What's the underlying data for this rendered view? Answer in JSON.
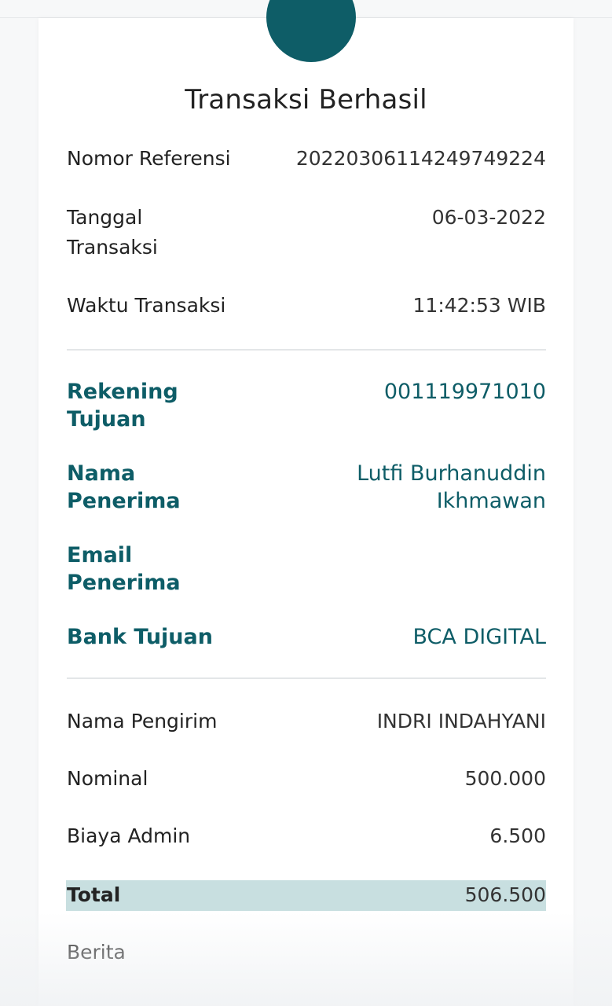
{
  "title": "Transaksi Berhasil",
  "colors": {
    "accent": "#0e5d67",
    "total_highlight": "#c8dfe0"
  },
  "icons": {
    "status": "check-icon"
  },
  "details": {
    "ref_label": "Nomor Referensi",
    "ref_value": "20220306114249749224",
    "date_label": "Tanggal Transaksi",
    "date_value": "06-03-2022",
    "time_label": "Waktu Transaksi",
    "time_value": "11:42:53 WIB"
  },
  "recipient": {
    "account_label": "Rekening Tujuan",
    "account_value": "001119971010",
    "name_label": "Nama Penerima",
    "name_value": "Lutfi Burhanuddin Ikhmawan",
    "email_label": "Email Penerima",
    "email_value": "",
    "bank_label": "Bank Tujuan",
    "bank_value": "BCA DIGITAL"
  },
  "payment": {
    "sender_label": "Nama Pengirim",
    "sender_value": "INDRI INDAHYANI",
    "nominal_label": "Nominal",
    "nominal_value": "500.000",
    "fee_label": "Biaya Admin",
    "fee_value": "6.500",
    "total_label": "Total",
    "total_value": "506.500",
    "note_label": "Berita",
    "note_value": ""
  }
}
